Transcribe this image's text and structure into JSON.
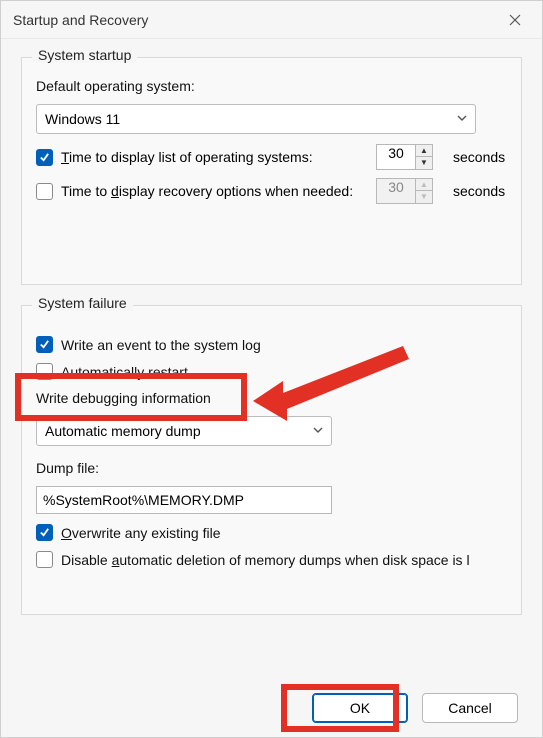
{
  "window": {
    "title": "Startup and Recovery"
  },
  "startup": {
    "group_label": "System startup",
    "default_os_label": "Default operating system:",
    "default_os_value": "Windows 11",
    "time_list_label_pre": "T",
    "time_list_label_rest": "ime to display list of operating systems:",
    "time_list_value": "30",
    "time_recovery_label_pre": "Time to ",
    "time_recovery_label_u": "d",
    "time_recovery_label_rest": "isplay recovery options when needed:",
    "time_recovery_value": "30",
    "seconds_label": "seconds"
  },
  "failure": {
    "group_label": "System failure",
    "write_event_label": "Write an event to the system log",
    "auto_restart_pre": "Automatically ",
    "auto_restart_u": "r",
    "auto_restart_rest": "estart",
    "debug_label": "Write debugging information",
    "debug_value": "Automatic memory dump",
    "dumpfile_label": "Dump file:",
    "dumpfile_value": "%SystemRoot%\\MEMORY.DMP",
    "overwrite_pre": "O",
    "overwrite_rest": "verwrite any existing file",
    "disable_auto_pre": "Disable ",
    "disable_auto_u": "a",
    "disable_auto_rest": "utomatic deletion of memory dumps when disk space is l"
  },
  "buttons": {
    "ok": "OK",
    "cancel": "Cancel"
  },
  "state": {
    "time_list_checked": true,
    "time_recovery_checked": false,
    "write_event_checked": true,
    "auto_restart_checked": false,
    "overwrite_checked": true,
    "disable_auto_checked": false
  }
}
